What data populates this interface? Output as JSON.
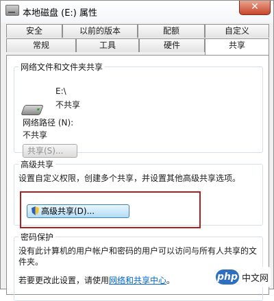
{
  "window": {
    "title": "本地磁盘 (E:) 属性",
    "close_label": "✕"
  },
  "tabs": {
    "row1": [
      "安全",
      "以前的版本",
      "配额",
      "自定义"
    ],
    "row2": [
      "常规",
      "工具",
      "硬件",
      "共享"
    ],
    "active": "共享"
  },
  "network_sharing": {
    "heading": "网络文件和文件夹共享",
    "drive_path": "E:\\",
    "drive_status": "不共享",
    "path_label": "网络路径 (N):",
    "path_value": "不共享",
    "share_button": "共享(S)..."
  },
  "advanced_sharing": {
    "heading": "高级共享",
    "description": "设置自定义权限，创建多个共享，并设置其他高级共享选项。",
    "button": "高级共享(D)..."
  },
  "password": {
    "heading": "密码保护",
    "description": "没有此计算机的用户帐户和密码的用户可以访问与所有人共享的文件夹。",
    "change_prefix": "若要更改此设置，请使用",
    "link": "网络和共享中心",
    "suffix": "。"
  },
  "watermark": {
    "logo": "php",
    "text": "中文网"
  },
  "colors": {
    "highlight_border": "#b01e1e",
    "link": "#0066cc",
    "close_button": "#c8462c"
  }
}
